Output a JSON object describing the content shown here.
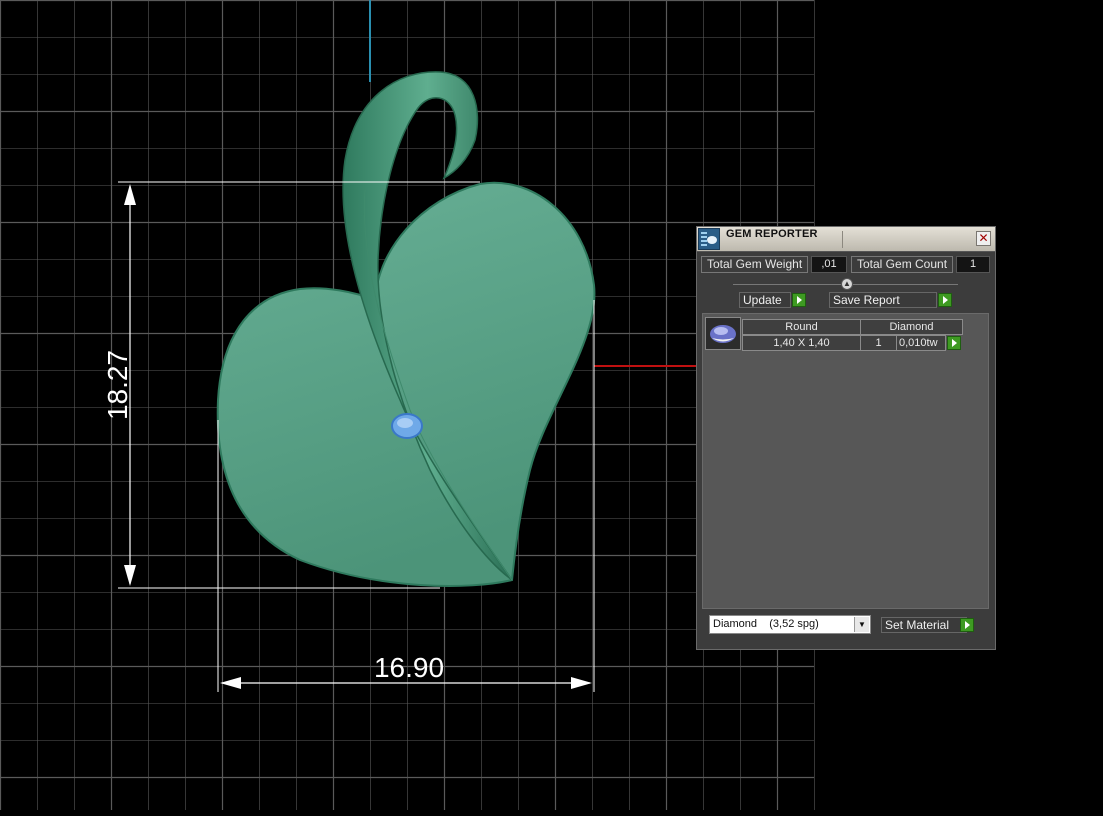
{
  "viewport": {
    "dim_height_label": "18.27",
    "dim_width_label": "16.90",
    "colors": {
      "background": "#000000",
      "grid_line": "#5a5a5a",
      "model_fill": "#5fa88a",
      "model_edge": "#2f7a5e",
      "gem": "#6fa9e8",
      "dimension": "#ffffff",
      "axis_x": "#c01010",
      "axis_y": "#2a8fb0"
    }
  },
  "panel": {
    "title": "GEM REPORTER",
    "icon": "gem-reporter-icon",
    "close_icon": "close-icon",
    "total_weight_label": "Total Gem Weight",
    "total_weight_value": ",01",
    "total_count_label": "Total Gem Count",
    "total_count_value": "1",
    "update_label": "Update",
    "save_report_label": "Save Report",
    "gems": {
      "header_shape": "Round",
      "header_material": "Diamond",
      "row_size": "1,40 X 1,40",
      "row_count": "1",
      "row_weight": "0,010tw"
    },
    "material_select": "Diamond    (3,52 spg)",
    "set_material_label": "Set Material"
  }
}
